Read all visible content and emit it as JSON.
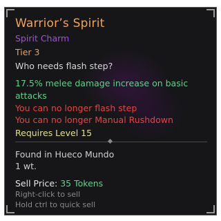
{
  "item": {
    "name": "Warrior’s Spirit",
    "type": "Spirit Charm",
    "tier": "Tier 3",
    "flavor": "Who needs flash step?",
    "effects": {
      "bonus": "17.5% melee damage increase on basic attacks",
      "penalties": [
        "You can no longer flash step",
        "You can no longer Manual Rushdown"
      ]
    },
    "requirement": "Requires Level 15",
    "origin": "Found in Hueco Mundo",
    "weight": "1 wt.",
    "sell": {
      "label": "Sell Price:",
      "amount": "35 Tokens"
    },
    "hints": [
      "Right-click to sell",
      "Hold ctrl to quick sell"
    ]
  },
  "colors": {
    "name": "#f0a35e",
    "type": "#a34fe0",
    "bonus": "#5fd28b",
    "penalty": "#e84343",
    "requirement": "#e3e08a",
    "hint": "#8a8a8a",
    "background": "#161618"
  }
}
